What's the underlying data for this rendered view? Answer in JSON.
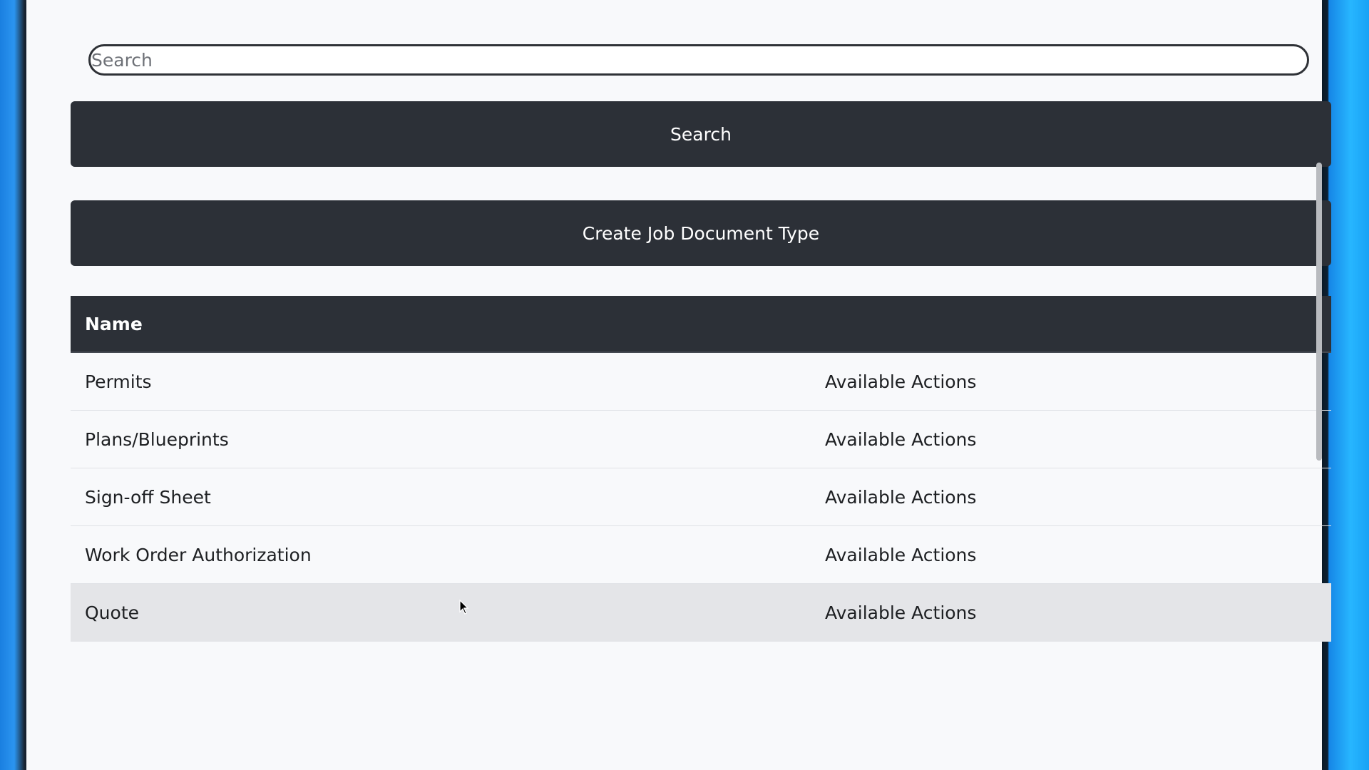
{
  "search": {
    "placeholder": "Search",
    "button_label": "Search"
  },
  "create_button_label": "Create Job Document Type",
  "table": {
    "header": "Name",
    "rows": [
      {
        "name": "Permits",
        "actions": "Available Actions"
      },
      {
        "name": "Plans/Blueprints",
        "actions": "Available Actions"
      },
      {
        "name": "Sign-off Sheet",
        "actions": "Available Actions"
      },
      {
        "name": "Work Order Authorization",
        "actions": "Available Actions"
      },
      {
        "name": "Quote",
        "actions": "Available Actions"
      }
    ]
  },
  "colors": {
    "dark": "#2c3037",
    "background": "#f8f9fb",
    "hover_row": "#e4e5e8"
  }
}
